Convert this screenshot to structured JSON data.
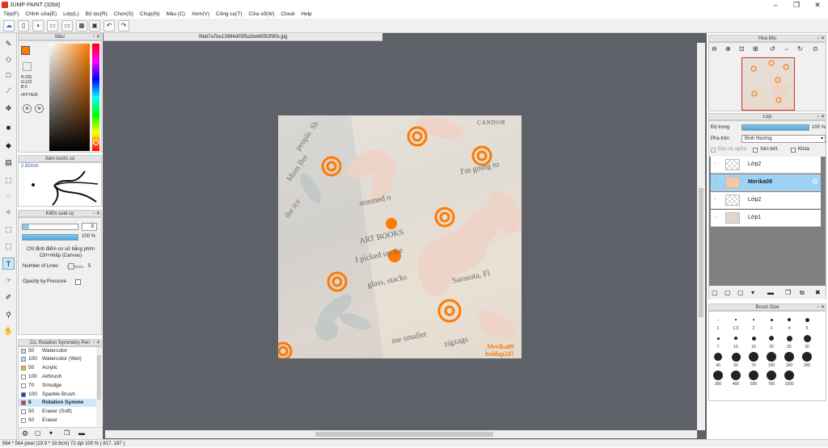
{
  "window": {
    "title": "JUMP PAINT (32bit)",
    "min": "–",
    "max": "❐",
    "close": "✕"
  },
  "menu": [
    "Tệp(F)",
    "Chỉnh sửa(E)",
    "Lớp(L)",
    "Bộ lọc(R)",
    "Chọn(S)",
    "Chụp(N)",
    "Màu (C)",
    "Xem(V)",
    "Công cụ(T)",
    "Cửa sổ(W)",
    "Cloud",
    "Help"
  ],
  "file_tab": "0feb7a7be13994d05f5a3bd455f2f90b.jpg",
  "color_panel": {
    "title": "Màu",
    "r": "R:255",
    "g": "G:122",
    "b": "B:0",
    "hex": "#FF7A00",
    "fg_color": "#FF7A00"
  },
  "preview_panel": {
    "title": "Xem trước cọ",
    "size": "2.82mm"
  },
  "brush_control": {
    "title": "Kiểm soát cọ",
    "size_value": "8",
    "opacity_value": "100 %",
    "hint_line1": "Chỉ định điểm cơ sở bằng phím",
    "hint_line2": "Ctrl+nhấp (Canvas)",
    "lines_label": "Number of Lines",
    "lines_value": "5",
    "pressure_label": "Opacity by Pressure"
  },
  "brush_list": {
    "title": "Cọ: Rotation Symmetry Pen",
    "items": [
      {
        "size": "50",
        "name": "Watercolor",
        "color": "#a8e4f4"
      },
      {
        "size": "100",
        "name": "Watercolor (Wet)",
        "color": "#a8e4f4"
      },
      {
        "size": "50",
        "name": "Acrylic",
        "color": "#f4c400"
      },
      {
        "size": "100",
        "name": "Airbrush",
        "color": "#ffffff"
      },
      {
        "size": "70",
        "name": "Smudge",
        "color": "#ffffff"
      },
      {
        "size": "100",
        "name": "Sparkle Brush",
        "color": "#1c3fc8"
      },
      {
        "size": "8",
        "name": "Rotation Symme",
        "color": "#e03030"
      },
      {
        "size": "50",
        "name": "Eraser (Soft)",
        "color": "#ffffff"
      },
      {
        "size": "50",
        "name": "Eraser",
        "color": "#ffffff"
      }
    ]
  },
  "navigator": {
    "title": "Hoa tiêu"
  },
  "layers_panel": {
    "title": "Lớp",
    "opacity_label": "Độ trong",
    "opacity_value": "100 %",
    "blend_label": "Pha trộn",
    "blend_value": "Bình thường",
    "protect_alpha": "Bảo vệ alpha",
    "clipping": "Xén bớt",
    "lock": "Khóa",
    "layers": [
      "Lớp2",
      "Merika09",
      "Lớp2",
      "Lớp1"
    ]
  },
  "brush_size_panel": {
    "title": "Brush Size",
    "sizes": [
      "1",
      "1.5",
      "2",
      "3",
      "4",
      "5",
      "7",
      "10",
      "15",
      "20",
      "25",
      "30",
      "40",
      "50",
      "70",
      "100",
      "150",
      "200",
      "300",
      "400",
      "500",
      "700",
      "1000"
    ]
  },
  "artwork": {
    "signature_line1": "Merika09",
    "signature_line2": "holdap247",
    "book_word": "CANDOR",
    "page_texts": [
      "people. Sh",
      "Mom Bet",
      "the ice",
      "ART BOOKS",
      "I picked up the",
      "stormed o",
      "glass, stacks",
      "Sarasota, Fl",
      "I'm going to",
      "me smaller",
      "zigzags"
    ]
  },
  "status": "564 * 564 pixel  (19.9 * 19.9cm)  72 dpi  100 %  ( 817, 187 )"
}
